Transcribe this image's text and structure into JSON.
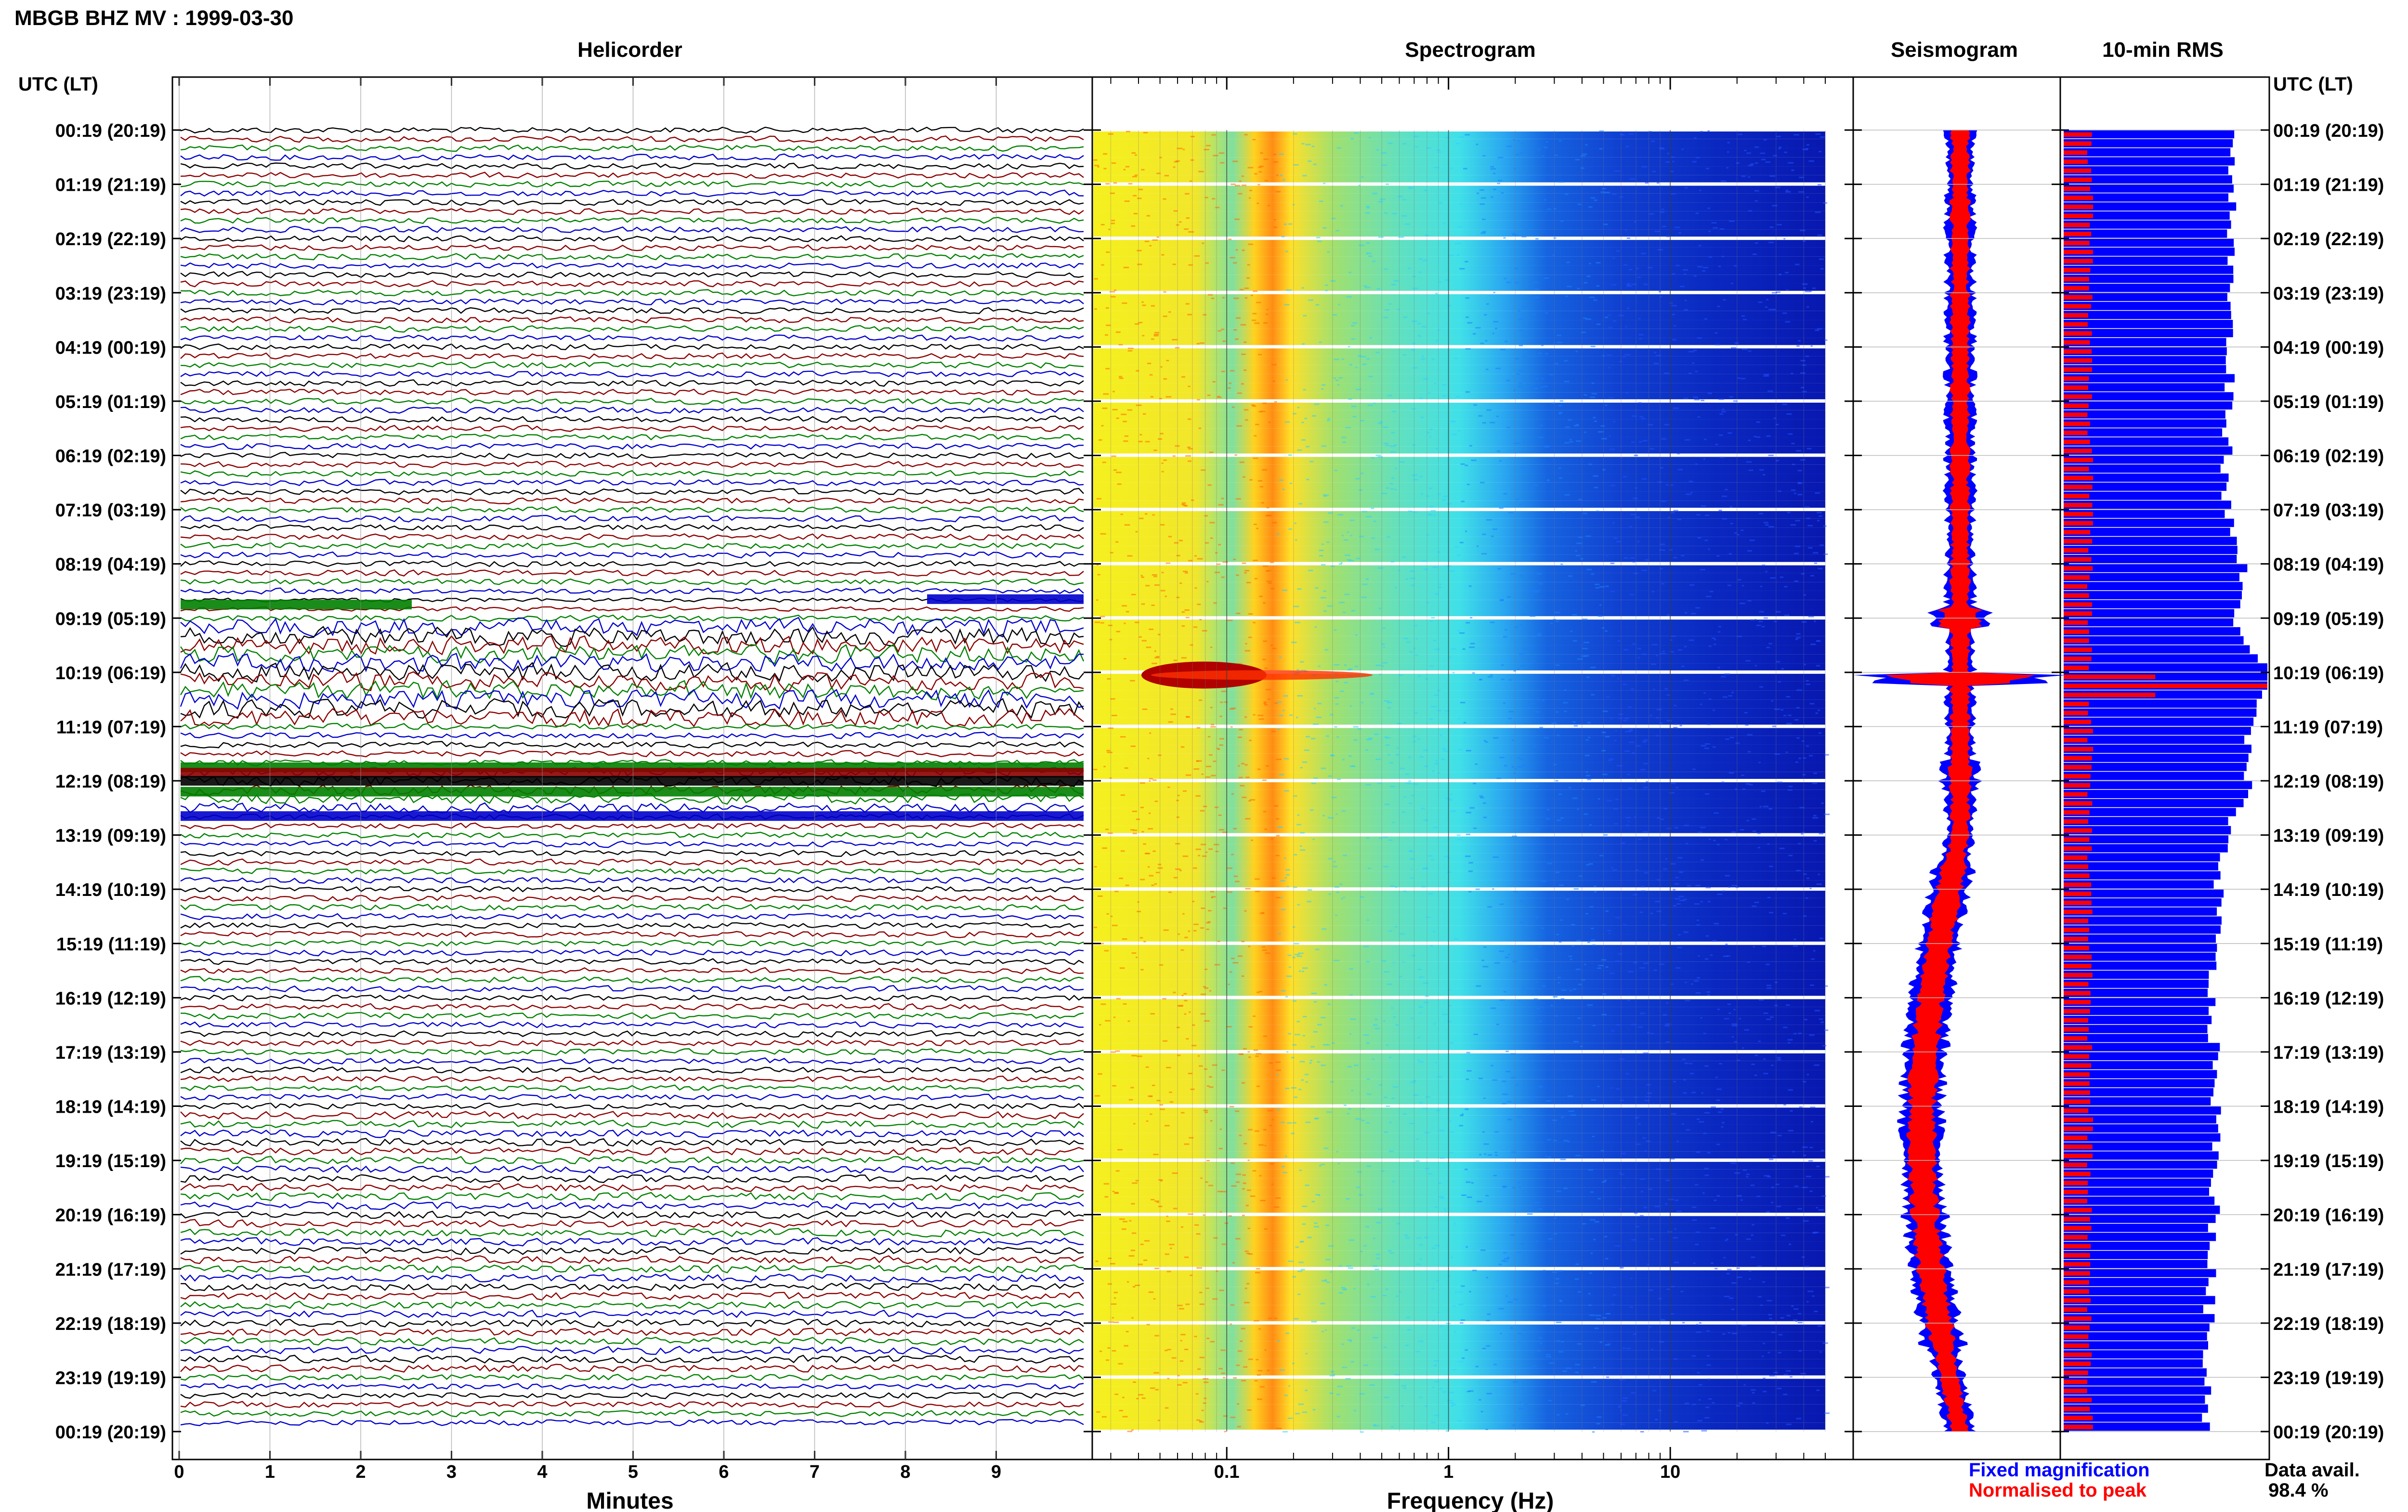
{
  "page_title": "MBGB BHZ MV : 1999-03-30",
  "panels": {
    "helicorder": "Helicorder",
    "spectrogram": "Spectrogram",
    "seismogram": "Seismogram",
    "rms": "10-min RMS"
  },
  "axis_header_left": "UTC (LT)",
  "axis_header_right": "UTC (LT)",
  "footer": {
    "helicorder_xlabel": "Minutes",
    "spectrogram_xlabel": "Frequency (Hz)",
    "legend_fixed": "Fixed magnification",
    "legend_normalised": "Normalised to peak",
    "data_avail_label": "Data avail.",
    "data_avail_value": "98.4 %"
  },
  "colors": {
    "trace_cycle": [
      "#000000",
      "#8b0000",
      "#008000",
      "#0000cd"
    ],
    "fixed": "#0000ff",
    "normalised": "#ff0000"
  },
  "chart_data": [
    {
      "type": "line",
      "panel": "helicorder",
      "xlabel": "Minutes",
      "x_ticks": [
        "0",
        "1",
        "2",
        "3",
        "4",
        "5",
        "6",
        "7",
        "8",
        "9"
      ],
      "xlim": [
        0,
        10
      ],
      "y_tick_labels": [
        "00:19 (20:19)",
        "01:19 (21:19)",
        "02:19 (22:19)",
        "03:19 (23:19)",
        "04:19 (00:19)",
        "05:19 (01:19)",
        "06:19 (02:19)",
        "07:19 (03:19)",
        "08:19 (04:19)",
        "09:19 (05:19)",
        "10:19 (06:19)",
        "11:19 (07:19)",
        "12:19 (08:19)",
        "13:19 (09:19)",
        "14:19 (10:19)",
        "15:19 (11:19)",
        "16:19 (12:19)",
        "17:19 (13:19)",
        "18:19 (14:19)",
        "19:19 (15:19)",
        "20:19 (16:19)",
        "21:19 (17:19)",
        "22:19 (18:19)",
        "23:19 (19:19)",
        "00:19 (20:19)"
      ],
      "lines_per_day": 144,
      "line_minutes": 10,
      "events": [
        {
          "time": "10:19",
          "label": ""
        }
      ]
    },
    {
      "type": "heatmap",
      "panel": "spectrogram",
      "xlabel": "Frequency (Hz)",
      "x_scale": "log",
      "x_ticks": [
        "0.1",
        "1",
        "10"
      ],
      "xlim": [
        0.025,
        50
      ]
    },
    {
      "type": "area",
      "panel": "seismogram",
      "series": [
        {
          "name": "Fixed magnification"
        },
        {
          "name": "Normalised to peak"
        }
      ]
    },
    {
      "type": "bar",
      "panel": "rms",
      "series": [
        {
          "name": "Fixed magnification"
        },
        {
          "name": "Normalised to peak"
        }
      ],
      "rms_profile_hours": [
        0,
        1,
        2,
        3,
        4,
        5,
        6,
        7,
        8,
        9,
        10,
        11,
        12,
        13,
        14,
        15,
        16,
        17,
        18,
        19,
        20,
        21,
        22,
        23,
        24
      ],
      "rms_profile_fraction": [
        0.82,
        0.83,
        0.82,
        0.82,
        0.81,
        0.81,
        0.8,
        0.8,
        0.88,
        0.85,
        1.0,
        0.9,
        0.9,
        0.78,
        0.76,
        0.74,
        0.72,
        0.74,
        0.75,
        0.74,
        0.74,
        0.72,
        0.71,
        0.71,
        0.7
      ]
    }
  ]
}
